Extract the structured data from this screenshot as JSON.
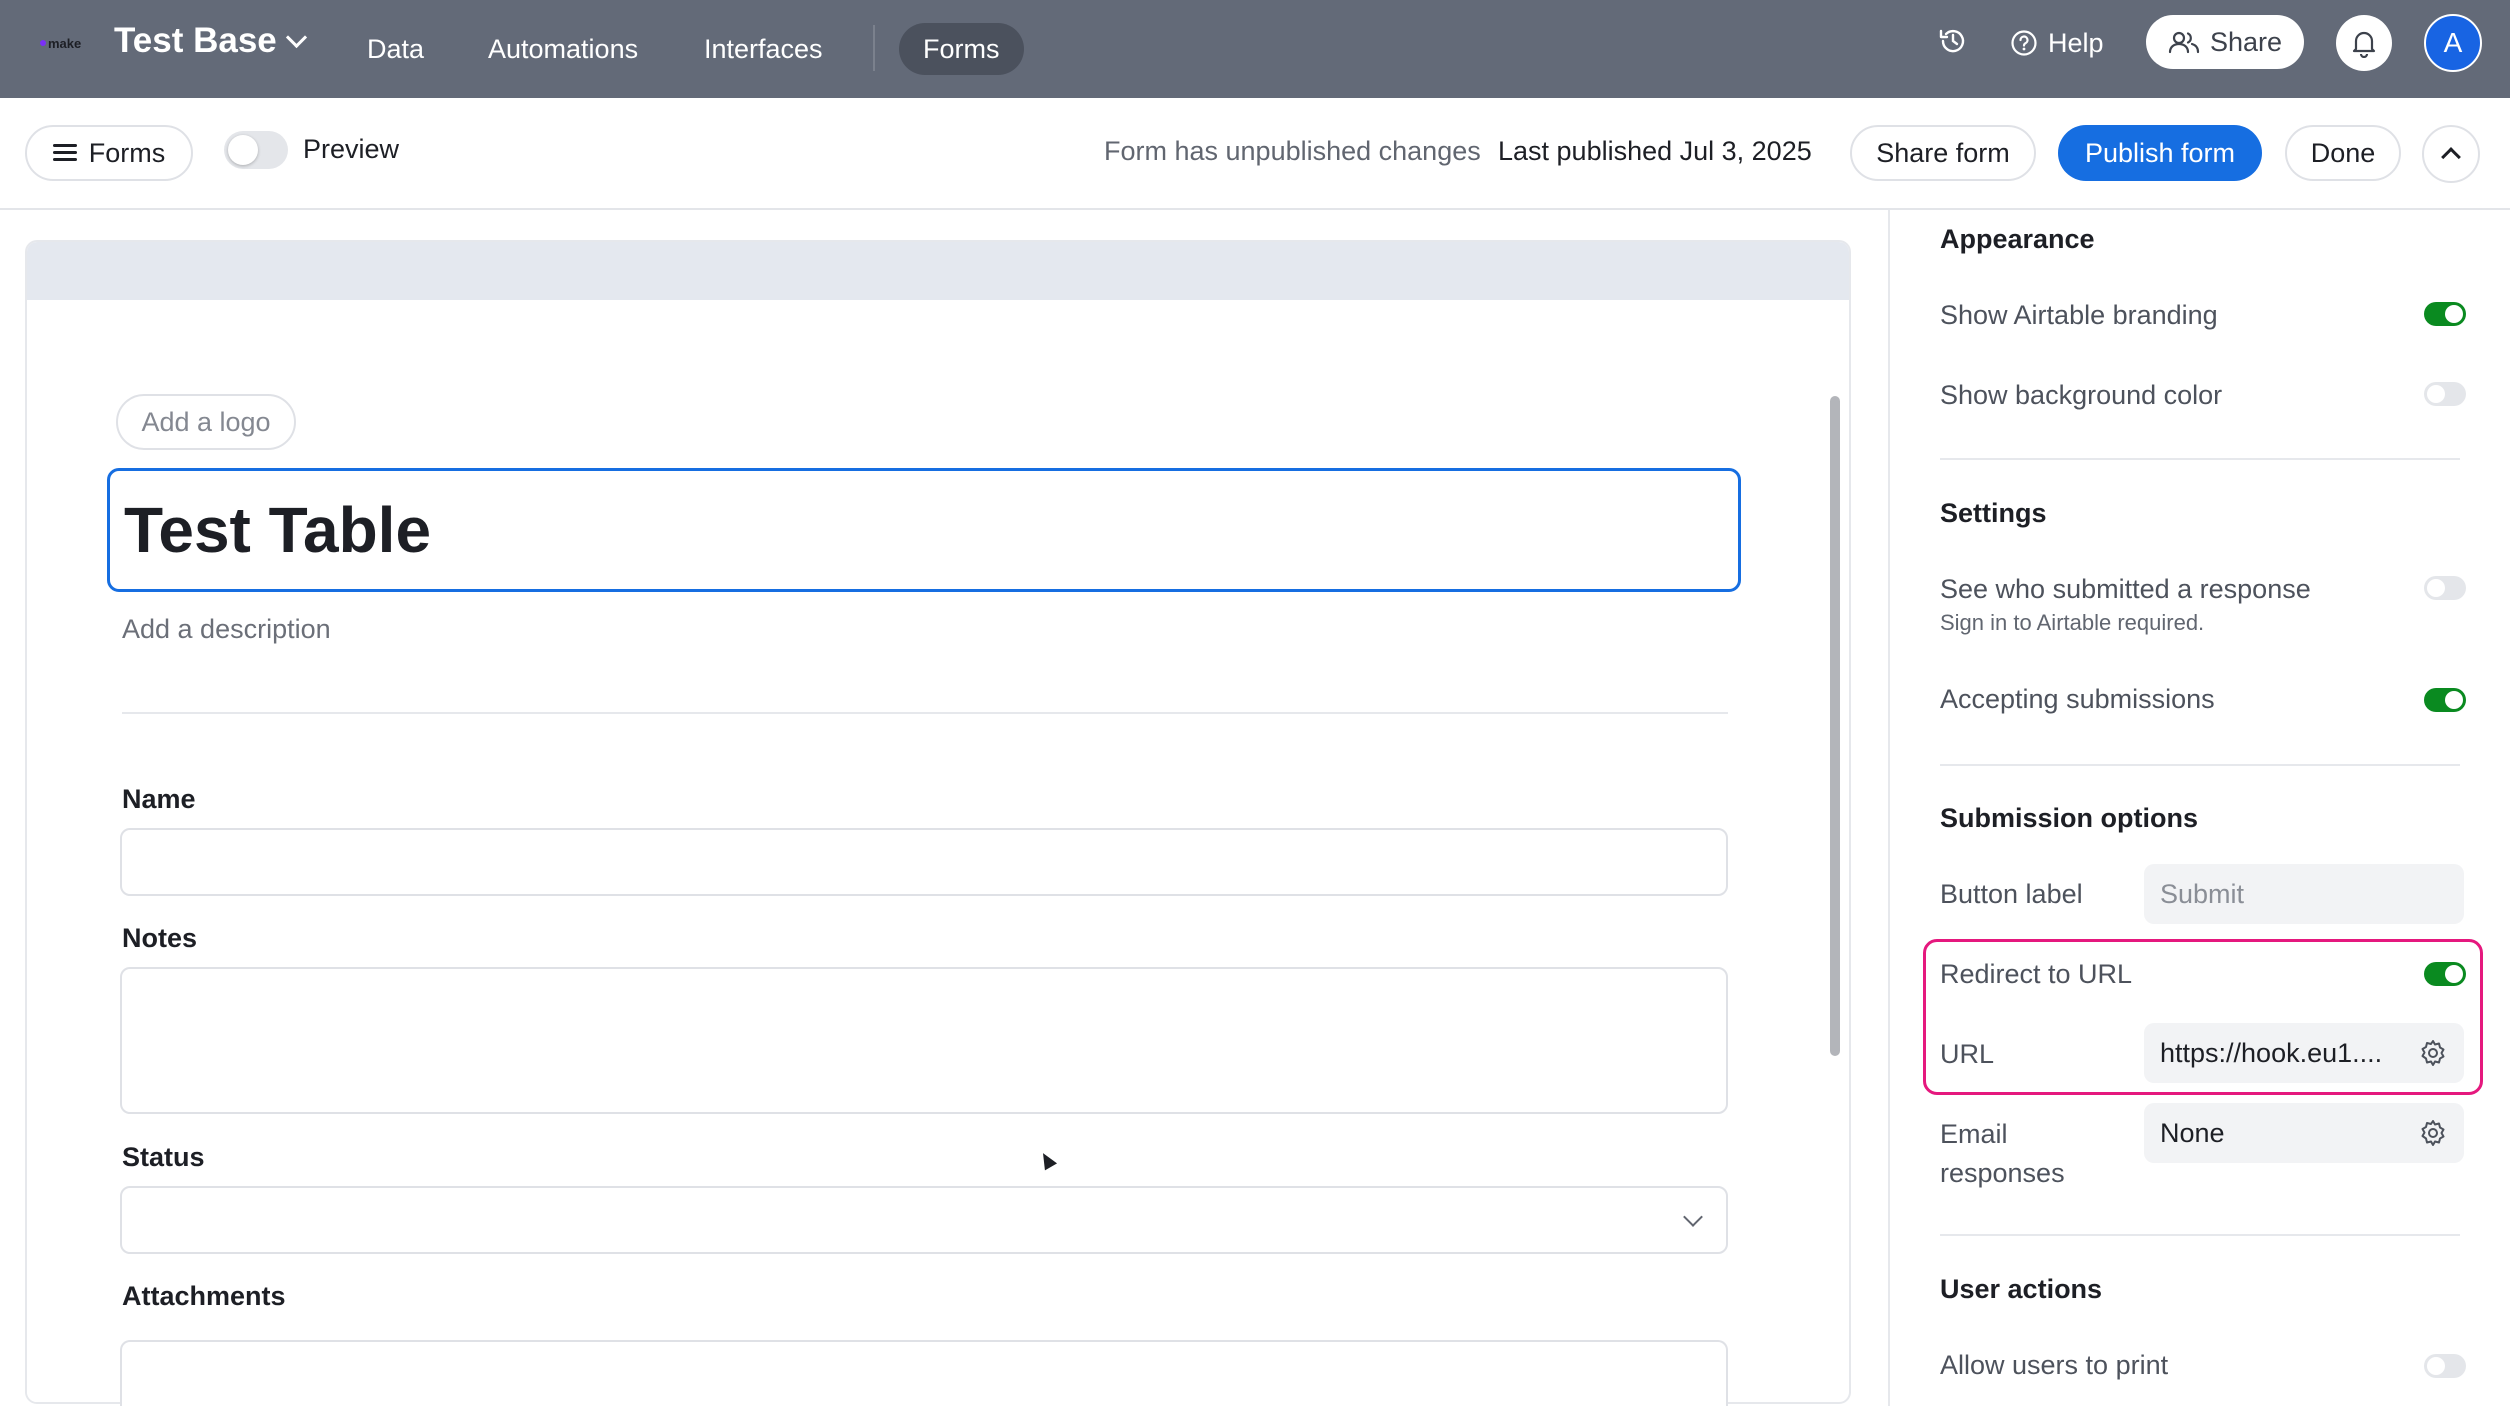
{
  "topbar": {
    "logo_text": "make",
    "base_name": "Test Base",
    "nav": [
      "Data",
      "Automations",
      "Interfaces",
      "Forms"
    ],
    "active_nav": "Forms",
    "help_label": "Help",
    "share_label": "Share",
    "avatar_initial": "A"
  },
  "subbar": {
    "forms_label": "Forms",
    "preview_label": "Preview",
    "unpublished_text": "Form has unpublished changes",
    "last_published_text": "Last published Jul 3, 2025",
    "share_form_label": "Share form",
    "publish_label": "Publish form",
    "done_label": "Done"
  },
  "form": {
    "add_logo_label": "Add a logo",
    "title": "Test Table",
    "description_placeholder": "Add a description",
    "fields": {
      "name": "Name",
      "notes": "Notes",
      "status": "Status",
      "attachments": "Attachments"
    }
  },
  "panel": {
    "appearance": {
      "title": "Appearance",
      "show_branding": "Show Airtable branding",
      "show_branding_on": true,
      "show_bg_color": "Show background color",
      "show_bg_color_on": false
    },
    "settings": {
      "title": "Settings",
      "see_who": "See who submitted a response",
      "see_who_sub": "Sign in to Airtable required.",
      "see_who_on": false,
      "accepting": "Accepting submissions",
      "accepting_on": true
    },
    "submission": {
      "title": "Submission options",
      "button_label": "Button label",
      "button_placeholder": "Submit",
      "redirect": "Redirect to URL",
      "redirect_on": true,
      "url_label": "URL",
      "url_value": "https://hook.eu1....",
      "email_label_1": "Email",
      "email_label_2": "responses",
      "email_value": "None"
    },
    "user_actions": {
      "title": "User actions",
      "allow_print": "Allow users to print",
      "allow_print_on": false
    }
  },
  "colors": {
    "topbar": "#636a78",
    "accent": "#166ee1",
    "toggle_on": "#0a8a20",
    "highlight": "#e5187e"
  }
}
